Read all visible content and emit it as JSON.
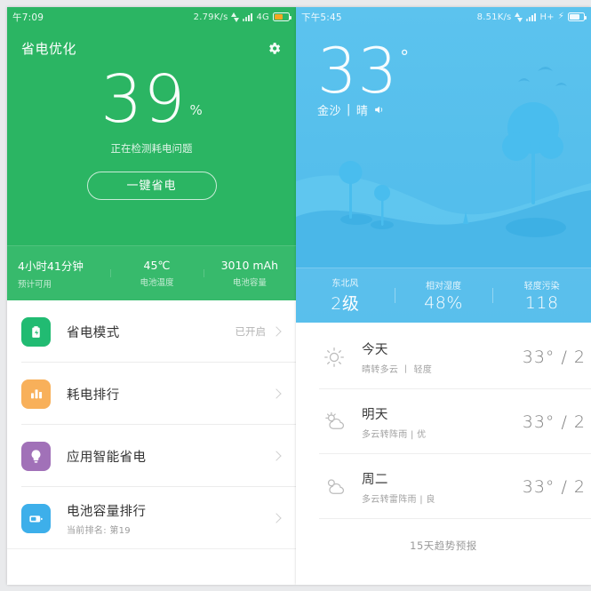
{
  "battery_app": {
    "statusbar": {
      "time": "午7:09",
      "net_speed": "2.79K/s",
      "network": "4G",
      "icons": [
        "data-transfer-icon",
        "signal-icon",
        "battery-icon"
      ]
    },
    "header": {
      "title": "省电优化",
      "settings_icon": "gear-icon"
    },
    "hero": {
      "percent": "39",
      "percent_symbol": "%",
      "status_text": "正在检测耗电问题",
      "action_label": "一键省电"
    },
    "stats": [
      {
        "value": "4小时41分钟",
        "label": "预计可用"
      },
      {
        "value": "45℃",
        "label": "电池温度"
      },
      {
        "value": "3010 mAh",
        "label": "电池容量"
      }
    ],
    "rows": [
      {
        "icon": "battery-bolt-icon",
        "color": "#21bb72",
        "title": "省电模式",
        "sub": "",
        "status": "已开启"
      },
      {
        "icon": "bar-chart-icon",
        "color": "#f8b05a",
        "title": "耗电排行",
        "sub": "",
        "status": ""
      },
      {
        "icon": "lightbulb-icon",
        "color": "#a濃",
        "title": "应用智能省电",
        "sub": "",
        "status": ""
      },
      {
        "icon": "battery-horizontal-icon",
        "color": "#3dafea",
        "title": "电池容量排行",
        "sub": "当前排名: 第19",
        "status": ""
      }
    ],
    "colors": {
      "hero_bg": "#2bb563",
      "hero_stats_bg": "#37ba6c",
      "icon_green": "#21bb72",
      "icon_orange": "#f8b05a",
      "icon_purple": "#a171b8",
      "icon_blue": "#3dafea"
    }
  },
  "weather_app": {
    "statusbar": {
      "time": "下午5:45",
      "net_speed": "8.51K/s",
      "network": "H+",
      "icons": [
        "data-transfer-icon",
        "signal-icon",
        "charging-bolt-icon",
        "battery-icon"
      ]
    },
    "current": {
      "temperature": "33",
      "degree": "°",
      "location": "金沙",
      "separator": "|",
      "condition": "晴",
      "speaker_icon": "speaker-icon"
    },
    "stats": [
      {
        "label": "东北风",
        "value": "2级"
      },
      {
        "label": "相对湿度",
        "value": "48%"
      },
      {
        "label": "轻度污染",
        "value": "118"
      }
    ],
    "forecast": [
      {
        "icon": "sun-icon",
        "day": "今天",
        "desc": "晴转多云  丨  轻度",
        "temp": "33° / 2"
      },
      {
        "icon": "sun-cloud-icon",
        "day": "明天",
        "desc": "多云转阵雨 | 优",
        "temp": "33° / 2"
      },
      {
        "icon": "cloud-icon",
        "day": "周二",
        "desc": "多云转雷阵雨 | 良",
        "temp": "33° / 2"
      }
    ],
    "more_label": "15天趋势预报",
    "colors": {
      "sky_top": "#5cc3ee",
      "sky_bottom": "#4fbbeb",
      "hill_far": "#63c8f0",
      "hill_near": "#46b4e6"
    }
  }
}
